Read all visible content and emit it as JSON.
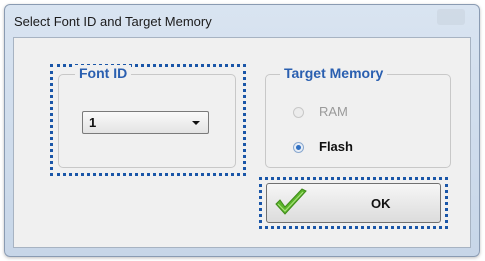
{
  "window": {
    "title": "Select Font ID and Target Memory"
  },
  "font_group": {
    "label": "Font ID",
    "selected_value": "1"
  },
  "memory_group": {
    "label": "Target Memory",
    "options": [
      {
        "label": "RAM",
        "enabled": false,
        "selected": false
      },
      {
        "label": "Flash",
        "enabled": true,
        "selected": true
      }
    ]
  },
  "buttons": {
    "ok_label": "OK"
  },
  "colors": {
    "group_label": "#2a5fb0",
    "focus_outline": "#1a56a8",
    "check_green": "#5bb52a"
  },
  "icons": {
    "ok_icon": "checkmark-icon",
    "combo_arrow": "chevron-down-icon"
  }
}
